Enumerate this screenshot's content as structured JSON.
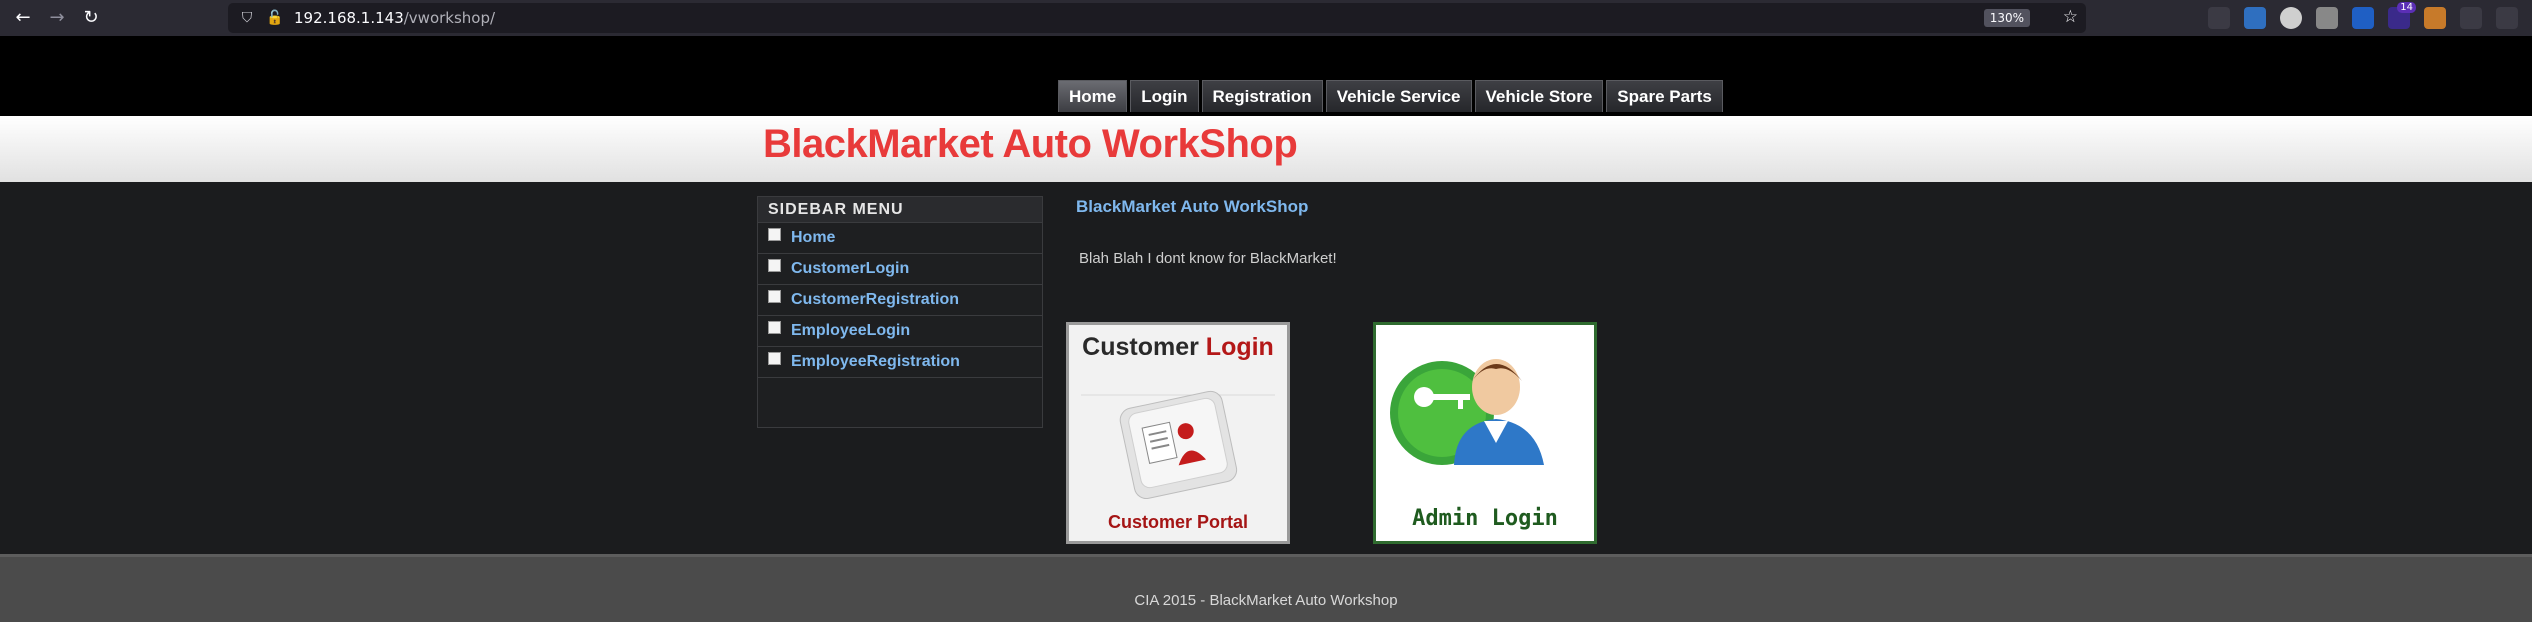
{
  "browser": {
    "url_host": "192.168.1.143",
    "url_path": "/vworkshop/",
    "zoom": "130%",
    "badge_count": "14",
    "back_icon": "back-arrow",
    "forward_icon": "forward-arrow",
    "reload_icon": "reload"
  },
  "nav": {
    "items": [
      {
        "label": "Home"
      },
      {
        "label": "Login"
      },
      {
        "label": "Registration"
      },
      {
        "label": "Vehicle Service"
      },
      {
        "label": "Vehicle Store"
      },
      {
        "label": "Spare Parts"
      }
    ]
  },
  "header": {
    "title": "BlackMarket Auto WorkShop"
  },
  "sidebar": {
    "heading": "SIDEBAR MENU",
    "items": [
      {
        "label": "Home"
      },
      {
        "label": "CustomerLogin"
      },
      {
        "label": "CustomerRegistration"
      },
      {
        "label": "EmployeeLogin"
      },
      {
        "label": "EmployeeRegistration"
      }
    ]
  },
  "main": {
    "title": "BlackMarket Auto WorkShop",
    "text": "Blah Blah I dont know for BlackMarket!",
    "customer_card": {
      "title_left": "Customer",
      "title_right": "Login",
      "subtitle": "Customer Portal"
    },
    "admin_card": {
      "label": "Admin Login"
    }
  },
  "footer": {
    "text": "CIA 2015 - BlackMarket Auto Workshop"
  },
  "colors": {
    "title_red": "#e83a3a",
    "link_blue": "#7fb8ee"
  }
}
